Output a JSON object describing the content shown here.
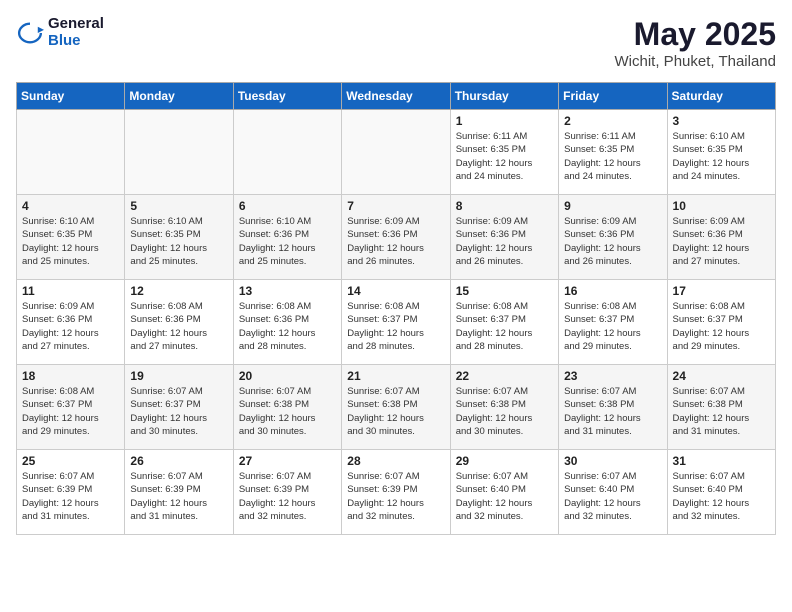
{
  "logo": {
    "general": "General",
    "blue": "Blue"
  },
  "title": {
    "month": "May 2025",
    "location": "Wichit, Phuket, Thailand"
  },
  "days_of_week": [
    "Sunday",
    "Monday",
    "Tuesday",
    "Wednesday",
    "Thursday",
    "Friday",
    "Saturday"
  ],
  "weeks": [
    [
      {
        "day": "",
        "info": ""
      },
      {
        "day": "",
        "info": ""
      },
      {
        "day": "",
        "info": ""
      },
      {
        "day": "",
        "info": ""
      },
      {
        "day": "1",
        "info": "Sunrise: 6:11 AM\nSunset: 6:35 PM\nDaylight: 12 hours\nand 24 minutes."
      },
      {
        "day": "2",
        "info": "Sunrise: 6:11 AM\nSunset: 6:35 PM\nDaylight: 12 hours\nand 24 minutes."
      },
      {
        "day": "3",
        "info": "Sunrise: 6:10 AM\nSunset: 6:35 PM\nDaylight: 12 hours\nand 24 minutes."
      }
    ],
    [
      {
        "day": "4",
        "info": "Sunrise: 6:10 AM\nSunset: 6:35 PM\nDaylight: 12 hours\nand 25 minutes."
      },
      {
        "day": "5",
        "info": "Sunrise: 6:10 AM\nSunset: 6:35 PM\nDaylight: 12 hours\nand 25 minutes."
      },
      {
        "day": "6",
        "info": "Sunrise: 6:10 AM\nSunset: 6:36 PM\nDaylight: 12 hours\nand 25 minutes."
      },
      {
        "day": "7",
        "info": "Sunrise: 6:09 AM\nSunset: 6:36 PM\nDaylight: 12 hours\nand 26 minutes."
      },
      {
        "day": "8",
        "info": "Sunrise: 6:09 AM\nSunset: 6:36 PM\nDaylight: 12 hours\nand 26 minutes."
      },
      {
        "day": "9",
        "info": "Sunrise: 6:09 AM\nSunset: 6:36 PM\nDaylight: 12 hours\nand 26 minutes."
      },
      {
        "day": "10",
        "info": "Sunrise: 6:09 AM\nSunset: 6:36 PM\nDaylight: 12 hours\nand 27 minutes."
      }
    ],
    [
      {
        "day": "11",
        "info": "Sunrise: 6:09 AM\nSunset: 6:36 PM\nDaylight: 12 hours\nand 27 minutes."
      },
      {
        "day": "12",
        "info": "Sunrise: 6:08 AM\nSunset: 6:36 PM\nDaylight: 12 hours\nand 27 minutes."
      },
      {
        "day": "13",
        "info": "Sunrise: 6:08 AM\nSunset: 6:36 PM\nDaylight: 12 hours\nand 28 minutes."
      },
      {
        "day": "14",
        "info": "Sunrise: 6:08 AM\nSunset: 6:37 PM\nDaylight: 12 hours\nand 28 minutes."
      },
      {
        "day": "15",
        "info": "Sunrise: 6:08 AM\nSunset: 6:37 PM\nDaylight: 12 hours\nand 28 minutes."
      },
      {
        "day": "16",
        "info": "Sunrise: 6:08 AM\nSunset: 6:37 PM\nDaylight: 12 hours\nand 29 minutes."
      },
      {
        "day": "17",
        "info": "Sunrise: 6:08 AM\nSunset: 6:37 PM\nDaylight: 12 hours\nand 29 minutes."
      }
    ],
    [
      {
        "day": "18",
        "info": "Sunrise: 6:08 AM\nSunset: 6:37 PM\nDaylight: 12 hours\nand 29 minutes."
      },
      {
        "day": "19",
        "info": "Sunrise: 6:07 AM\nSunset: 6:37 PM\nDaylight: 12 hours\nand 30 minutes."
      },
      {
        "day": "20",
        "info": "Sunrise: 6:07 AM\nSunset: 6:38 PM\nDaylight: 12 hours\nand 30 minutes."
      },
      {
        "day": "21",
        "info": "Sunrise: 6:07 AM\nSunset: 6:38 PM\nDaylight: 12 hours\nand 30 minutes."
      },
      {
        "day": "22",
        "info": "Sunrise: 6:07 AM\nSunset: 6:38 PM\nDaylight: 12 hours\nand 30 minutes."
      },
      {
        "day": "23",
        "info": "Sunrise: 6:07 AM\nSunset: 6:38 PM\nDaylight: 12 hours\nand 31 minutes."
      },
      {
        "day": "24",
        "info": "Sunrise: 6:07 AM\nSunset: 6:38 PM\nDaylight: 12 hours\nand 31 minutes."
      }
    ],
    [
      {
        "day": "25",
        "info": "Sunrise: 6:07 AM\nSunset: 6:39 PM\nDaylight: 12 hours\nand 31 minutes."
      },
      {
        "day": "26",
        "info": "Sunrise: 6:07 AM\nSunset: 6:39 PM\nDaylight: 12 hours\nand 31 minutes."
      },
      {
        "day": "27",
        "info": "Sunrise: 6:07 AM\nSunset: 6:39 PM\nDaylight: 12 hours\nand 32 minutes."
      },
      {
        "day": "28",
        "info": "Sunrise: 6:07 AM\nSunset: 6:39 PM\nDaylight: 12 hours\nand 32 minutes."
      },
      {
        "day": "29",
        "info": "Sunrise: 6:07 AM\nSunset: 6:40 PM\nDaylight: 12 hours\nand 32 minutes."
      },
      {
        "day": "30",
        "info": "Sunrise: 6:07 AM\nSunset: 6:40 PM\nDaylight: 12 hours\nand 32 minutes."
      },
      {
        "day": "31",
        "info": "Sunrise: 6:07 AM\nSunset: 6:40 PM\nDaylight: 12 hours\nand 32 minutes."
      }
    ]
  ]
}
